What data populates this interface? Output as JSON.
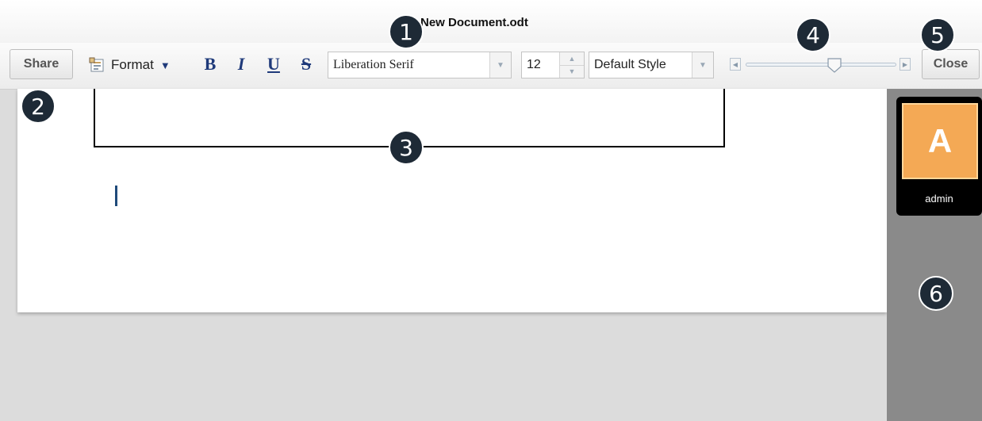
{
  "document": {
    "title": "New Document.odt"
  },
  "toolbar": {
    "share_label": "Share",
    "close_label": "Close",
    "format_label": "Format",
    "bold_label": "B",
    "italic_label": "I",
    "underline_label": "U",
    "strike_label": "S",
    "font_family": "Liberation Serif",
    "font_size": "12",
    "paragraph_style": "Default Style",
    "zoom_fraction": 0.6
  },
  "sidebar": {
    "user": {
      "initial": "A",
      "name": "admin",
      "avatar_color": "#f4a955"
    }
  },
  "markers": [
    "1",
    "2",
    "3",
    "4",
    "5",
    "6"
  ],
  "icons": [
    "format-icon",
    "dropdown-arrow-icon",
    "spin-up-icon",
    "spin-down-icon",
    "slider-left-icon",
    "slider-right-icon"
  ]
}
